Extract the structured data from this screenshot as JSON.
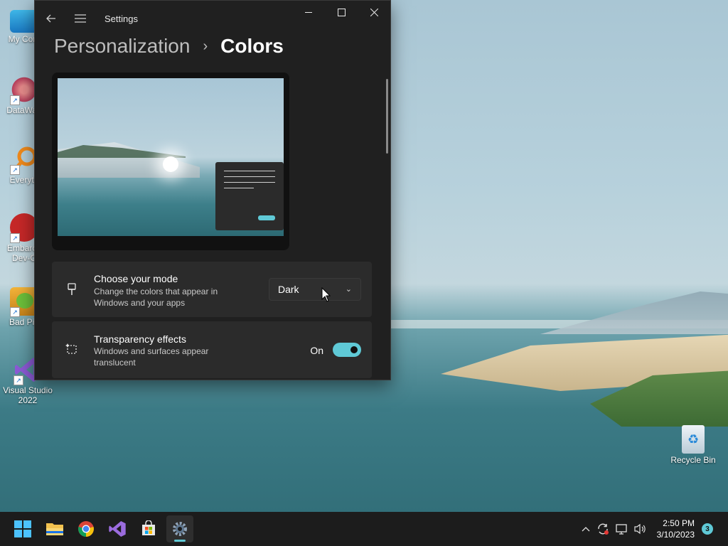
{
  "desktop": {
    "icons": [
      {
        "label": "My Com",
        "icon": "computer-icon"
      },
      {
        "label": "DataWag",
        "icon": "datawagon-icon"
      },
      {
        "label": "Everyth",
        "icon": "everything-search-icon"
      },
      {
        "label": "Embarca Dev-C",
        "icon": "devcpp-icon"
      },
      {
        "label": "Bad Pig",
        "icon": "bad-piggies-icon"
      },
      {
        "label": "Visual Studio 2022",
        "icon": "visual-studio-icon"
      }
    ],
    "recycle_bin": {
      "label": "Recycle Bin",
      "icon": "recycle-bin-icon"
    }
  },
  "window": {
    "app_title": "Settings",
    "breadcrumb": {
      "parent": "Personalization",
      "separator": "›",
      "current": "Colors"
    },
    "mode_card": {
      "title": "Choose your mode",
      "description": "Change the colors that appear in Windows and your apps",
      "selected": "Dark",
      "icon": "paintbrush-icon"
    },
    "transparency_card": {
      "title": "Transparency effects",
      "description": "Windows and surfaces appear translucent",
      "state_label": "On",
      "enabled": true,
      "icon": "transparency-icon"
    },
    "accent_color": "#5fc9d6"
  },
  "taskbar": {
    "apps": [
      "start-icon",
      "file-explorer-icon",
      "chrome-icon",
      "visual-studio-icon",
      "store-icon",
      "settings-icon"
    ],
    "tray": [
      "chevron-up-icon",
      "update-icon",
      "network-icon",
      "volume-icon"
    ],
    "time": "2:50 PM",
    "date": "3/10/2023",
    "notification_count": "3"
  }
}
